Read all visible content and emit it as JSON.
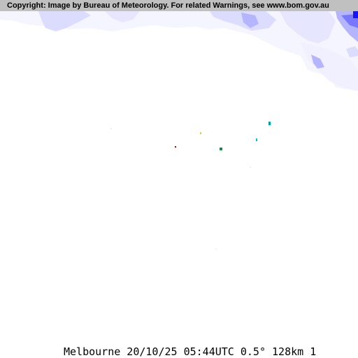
{
  "copyright": "Copyright: Image by Bureau of Meteorology. For related Warnings, see www.bom.gov.au",
  "caption": "Melbourne 20/10/25 05:44UTC 0.5° 128km 1",
  "colors": {
    "background": "#ffffff",
    "copyright_bar": "#c0c0c0",
    "echo_lightest": "#f5f5ff",
    "echo_light": "#b4b4ff",
    "echo_mid": "#7878ff",
    "echo_strong": "#1414ff",
    "speck_cyan": "#00a0a0",
    "speck_green": "#1a8a4a",
    "speck_yellow": "#e0e000",
    "speck_red": "#c00000"
  }
}
